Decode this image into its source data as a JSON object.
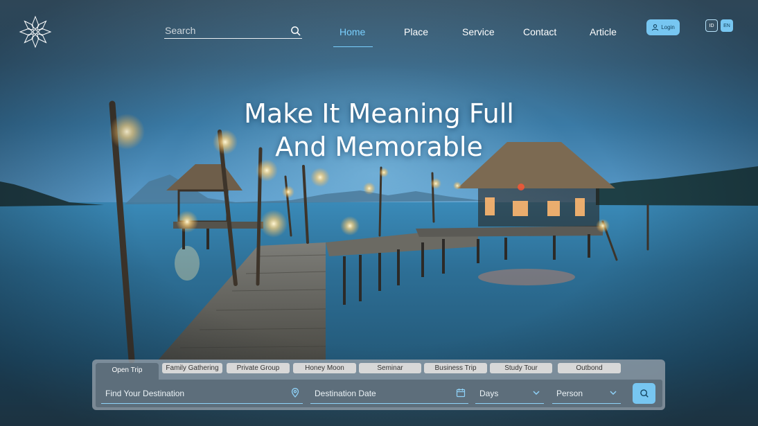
{
  "header": {
    "search_placeholder": "Search",
    "nav": [
      {
        "label": "Home",
        "active": true
      },
      {
        "label": "Place",
        "active": false
      },
      {
        "label": "Service",
        "active": false
      },
      {
        "label": "Contact",
        "active": false
      },
      {
        "label": "Article",
        "active": false
      }
    ],
    "login_label": "Login",
    "languages": [
      "ID",
      "EN"
    ],
    "selected_language": "EN"
  },
  "hero": {
    "line1": "Make It Meaning Full",
    "line2": "And Memorable"
  },
  "booking": {
    "tabs": [
      "Open Trip",
      "Family Gathering",
      "Private Group",
      "Honey Moon",
      "Seminar",
      "Business Trip",
      "Study Tour",
      "Outbond"
    ],
    "active_tab": "Open Trip",
    "destination": "Find Your Destination",
    "date": "Destination Date",
    "days": "Days",
    "person": "Person"
  },
  "icons": {
    "logo": "lotus-logo-icon",
    "search": "search-icon",
    "user": "user-icon",
    "location": "map-pin-icon",
    "calendar": "calendar-icon",
    "chevron": "chevron-down-icon"
  },
  "colors": {
    "accent": "#77c6f1",
    "active_nav": "#7ad0ff",
    "panel_inner": "#5d6e7b"
  }
}
